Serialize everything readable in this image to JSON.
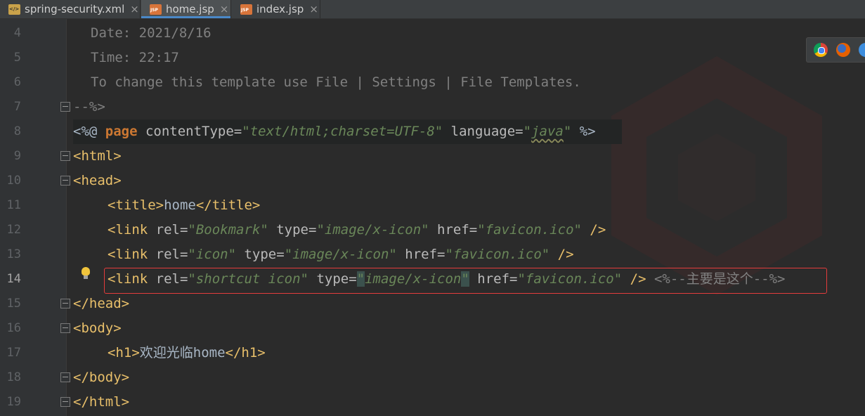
{
  "tabs": [
    {
      "label": "spring-security.xml",
      "icon": "xml-file-icon",
      "active": false
    },
    {
      "label": "home.jsp",
      "icon": "jsp-file-icon",
      "active": true
    },
    {
      "label": "index.jsp",
      "icon": "jsp-file-icon",
      "active": false
    }
  ],
  "close_glyph": "×",
  "line_numbers": [
    "4",
    "5",
    "6",
    "7",
    "8",
    "9",
    "10",
    "11",
    "12",
    "13",
    "14",
    "15",
    "16",
    "17",
    "18",
    "19"
  ],
  "current_line": "14",
  "code": {
    "l4": "Date: 2021/8/16",
    "l5": "Time: 22:17",
    "l6": "To change this template use File | Settings | File Templates.",
    "l7": "--%>",
    "l8": {
      "open": "<%@ ",
      "kw": "page",
      "attr1": " contentType=",
      "val1": "\"text/html;charset=UTF-8\"",
      "attr2": " language=",
      "val2_q1": "\"",
      "val2": "java",
      "val2_q2": "\"",
      "close": " %>"
    },
    "l9": "<html>",
    "l10": "<head>",
    "l11": {
      "open": "<title>",
      "text": "home",
      "close": "</title>"
    },
    "l12": {
      "open": "<link",
      "attr1": " rel=",
      "val1": "\"Bookmark\"",
      "attr2": " type=",
      "val2": "\"image/x-icon\"",
      "attr3": " href=",
      "val3": "\"favicon.ico\"",
      "close": " />"
    },
    "l13": {
      "open": "<link",
      "attr1": " rel=",
      "val1": "\"icon\"",
      "attr2": " type=",
      "val2": "\"image/x-icon\"",
      "attr3": " href=",
      "val3": "\"favicon.ico\"",
      "close": " />"
    },
    "l14": {
      "open": "<link",
      "attr1": " rel=",
      "val1": "\"shortcut icon\"",
      "attr2": " type=",
      "val2_q1": "\"",
      "val2": "image/x-icon",
      "val2_q2": "\"",
      "attr3": " href=",
      "val3": "\"favicon.ico\"",
      "close": " />",
      "comment": " <%--主要是这个--%>"
    },
    "l15": "</head>",
    "l16": "<body>",
    "l17": {
      "open": "<h1>",
      "text": "欢迎光临home",
      "close": "</h1>"
    },
    "l18": "</body>",
    "l19": "</html>"
  },
  "browsers": [
    "chrome-icon",
    "firefox-icon",
    "safari-icon"
  ],
  "colors": {
    "background": "#2b2b2b",
    "tag": "#e8bf6a",
    "string": "#6a8759",
    "keyword": "#cc7832",
    "comment": "#808080",
    "highlight_box": "#e43c3c",
    "active_tab_underline": "#4a88c7"
  }
}
